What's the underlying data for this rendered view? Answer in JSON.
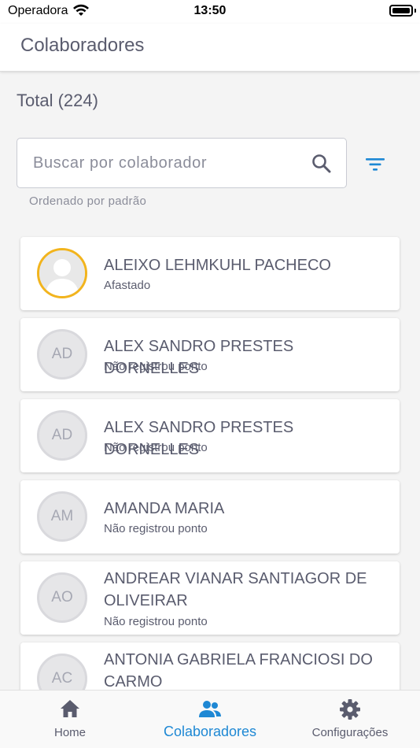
{
  "status_bar": {
    "carrier": "Operadora",
    "time": "13:50"
  },
  "header": {
    "title": "Colaboradores"
  },
  "summary": {
    "total": "Total (224)"
  },
  "search": {
    "placeholder": "Buscar por colaborador",
    "value": ""
  },
  "sort": {
    "label": "Ordenado por padrão"
  },
  "colors": {
    "accent": "#1e88d4",
    "avatar_ring_active": "#f2b41d",
    "text": "#5a5c6e"
  },
  "employees": [
    {
      "name": "ALEIXO LEHMKUHL PACHECO",
      "status": "Afastado",
      "initials": "",
      "avatar": "photo"
    },
    {
      "name": "ALEX SANDRO PRESTES DORNELLES",
      "status": "Não registrou ponto",
      "initials": "AD",
      "avatar": "initials"
    },
    {
      "name": "ALEX SANDRO PRESTES DORNELLES",
      "status": "Não registrou ponto",
      "initials": "AD",
      "avatar": "initials"
    },
    {
      "name": "AMANDA MARIA",
      "status": "Não registrou ponto",
      "initials": "AM",
      "avatar": "initials"
    },
    {
      "name": "ANDREAR VIANAR SANTIAGOR DE OLIVEIRAR",
      "status": "Não registrou ponto",
      "initials": "AO",
      "avatar": "initials"
    },
    {
      "name": "ANTONIA GABRIELA FRANCIOSI DO CARMO",
      "status": "",
      "initials": "AC",
      "avatar": "initials"
    }
  ],
  "nav": [
    {
      "label": "Home",
      "icon": "home-icon"
    },
    {
      "label": "Colaboradores",
      "icon": "people-icon",
      "active": true
    },
    {
      "label": "Configurações",
      "icon": "gear-icon"
    }
  ]
}
